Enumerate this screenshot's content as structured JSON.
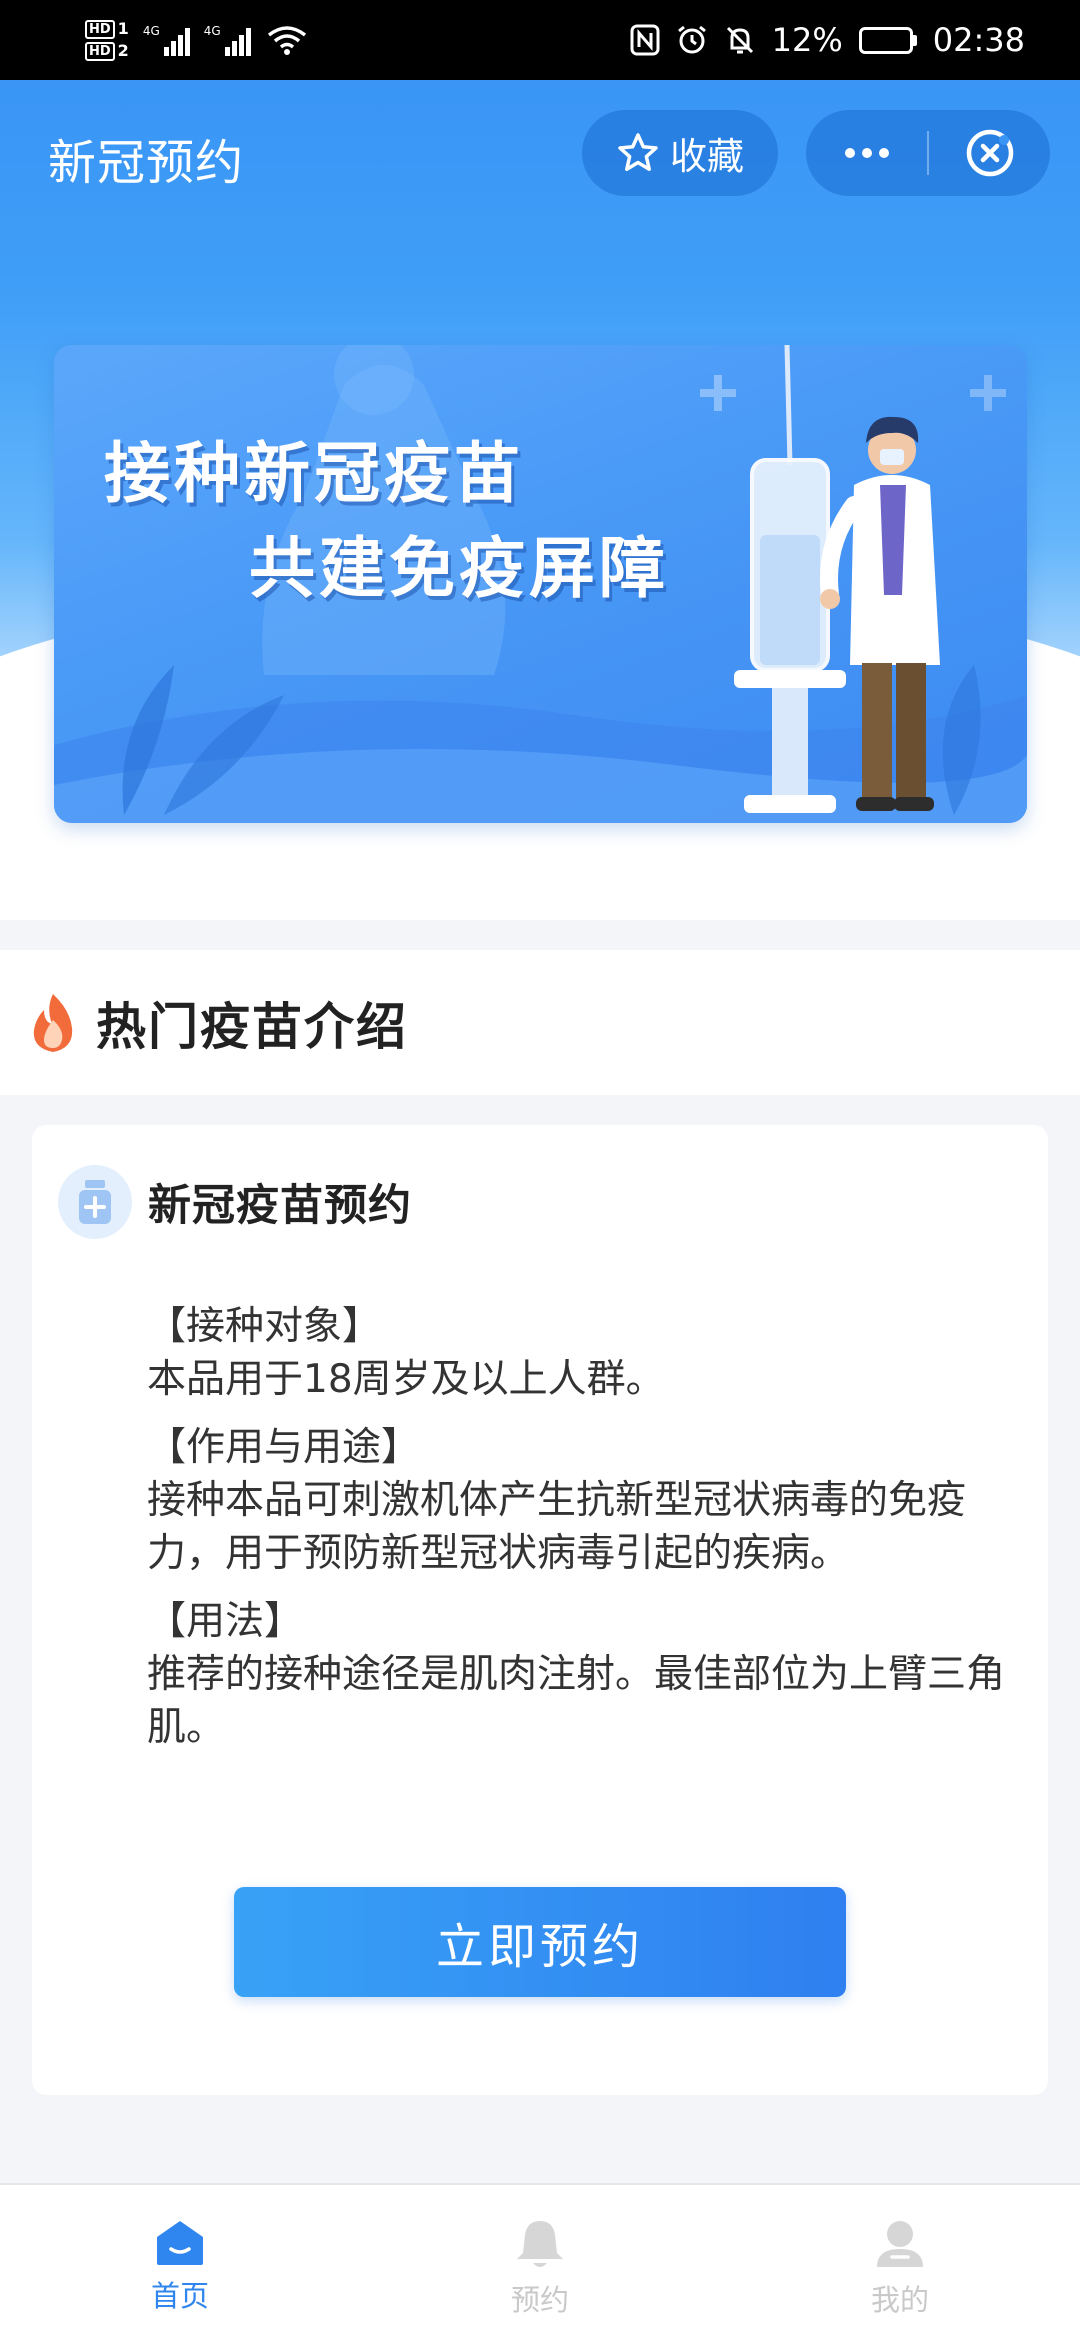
{
  "status_bar": {
    "hd1": "HD",
    "hd1_sub": "1",
    "hd2": "HD",
    "hd2_sub": "2",
    "net1": "4G",
    "net2": "4G",
    "battery_percent": "12%",
    "battery_level": 0.12,
    "time": "02:38",
    "icons": [
      "nfc-icon",
      "alarm-icon",
      "mute-icon",
      "wifi-icon",
      "signal-icon",
      "battery-icon"
    ]
  },
  "header": {
    "title": "新冠预约",
    "favorite_label": "收藏"
  },
  "banner": {
    "line1": "接种新冠疫苗",
    "line2": "共建免疫屏障"
  },
  "section": {
    "title": "热门疫苗介绍"
  },
  "card": {
    "title": "新冠疫苗预约",
    "blocks": [
      {
        "heading": "【接种对象】",
        "text": "本品用于18周岁及以上人群。"
      },
      {
        "heading": "【作用与用途】",
        "text": "接种本品可刺激机体产生抗新型冠状病毒的免疫力，用于预防新型冠状病毒引起的疾病。"
      },
      {
        "heading": "【用法】",
        "text": "推荐的接种途径是肌肉注射。最佳部位为上臂三角肌。"
      }
    ],
    "button_label": "立即预约"
  },
  "tabbar": {
    "items": [
      {
        "label": "首页",
        "active": true
      },
      {
        "label": "预约",
        "active": false
      },
      {
        "label": "我的",
        "active": false
      }
    ]
  },
  "colors": {
    "primary": "#3a95f5",
    "button": "#2f7ff0",
    "active_tab": "#2f86ee",
    "fire": "#f26b3a"
  }
}
